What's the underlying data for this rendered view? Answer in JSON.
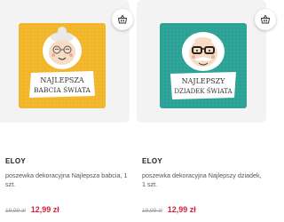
{
  "colors": {
    "accent_price": "#d2233c",
    "card_bg": "#f3f3f3",
    "cushion_left": "#f2b92f",
    "cushion_right": "#2fa59a"
  },
  "products": [
    {
      "brand": "ELOY",
      "name": "poszewka dekoracyjna Najlepsza babcia, 1 szt.",
      "old_price": "19,99 zł",
      "new_price": "12,99 zł",
      "image_text_line1": "NAJLEPSZA",
      "image_text_line2": "BABCIA ŚWIATA",
      "basket_icon": "basket-icon"
    },
    {
      "brand": "ELOY",
      "name": "poszewka dekoracyjna Najlepszy dziadek, 1 szt.",
      "old_price": "19,99 zł",
      "new_price": "12,99 zł",
      "image_text_line1": "NAJLEPSZY",
      "image_text_line2": "DZIADEK ŚWIATA",
      "basket_icon": "basket-icon"
    }
  ]
}
